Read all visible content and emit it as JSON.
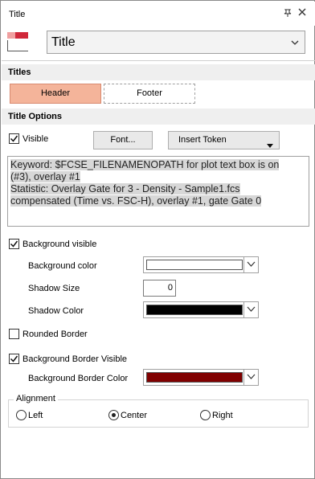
{
  "window": {
    "title": "Title"
  },
  "header": {
    "selected_value": "Title",
    "icon": "title-layout-icon"
  },
  "titles_section": {
    "heading": "Titles",
    "tabs": [
      {
        "label": "Header",
        "selected": true
      },
      {
        "label": "Footer",
        "selected": false
      }
    ]
  },
  "options_section": {
    "heading": "Title Options",
    "visible_label": "Visible",
    "visible_checked": true,
    "font_button": "Font...",
    "insert_token_button": "Insert Token",
    "text_lines": [
      "Keyword: $FCSE_FILENAMENOPATH for plot text box is on",
      "(#3), overlay #1",
      "Statistic: Overlay Gate for 3 - Density - Sample1.fcs",
      "compensated (Time vs. FSC-H), overlay #1, gate Gate 0"
    ]
  },
  "background": {
    "visible_label": "Background visible",
    "visible_checked": true,
    "color_label": "Background color",
    "color_value": "#ffffff",
    "shadow_size_label": "Shadow Size",
    "shadow_size_value": "0",
    "shadow_color_label": "Shadow Color",
    "shadow_color_value": "#000000"
  },
  "border": {
    "rounded_label": "Rounded Border",
    "rounded_checked": false,
    "visible_label": "Background Border Visible",
    "visible_checked": true,
    "color_label": "Background Border Color",
    "color_value": "#800000"
  },
  "alignment": {
    "heading": "Alignment",
    "options": [
      {
        "label": "Left",
        "selected": false
      },
      {
        "label": "Center",
        "selected": true
      },
      {
        "label": "Right",
        "selected": false
      }
    ]
  },
  "colors": {
    "accent_tab": "#f4b49a",
    "icon_red": "#d0283a"
  }
}
